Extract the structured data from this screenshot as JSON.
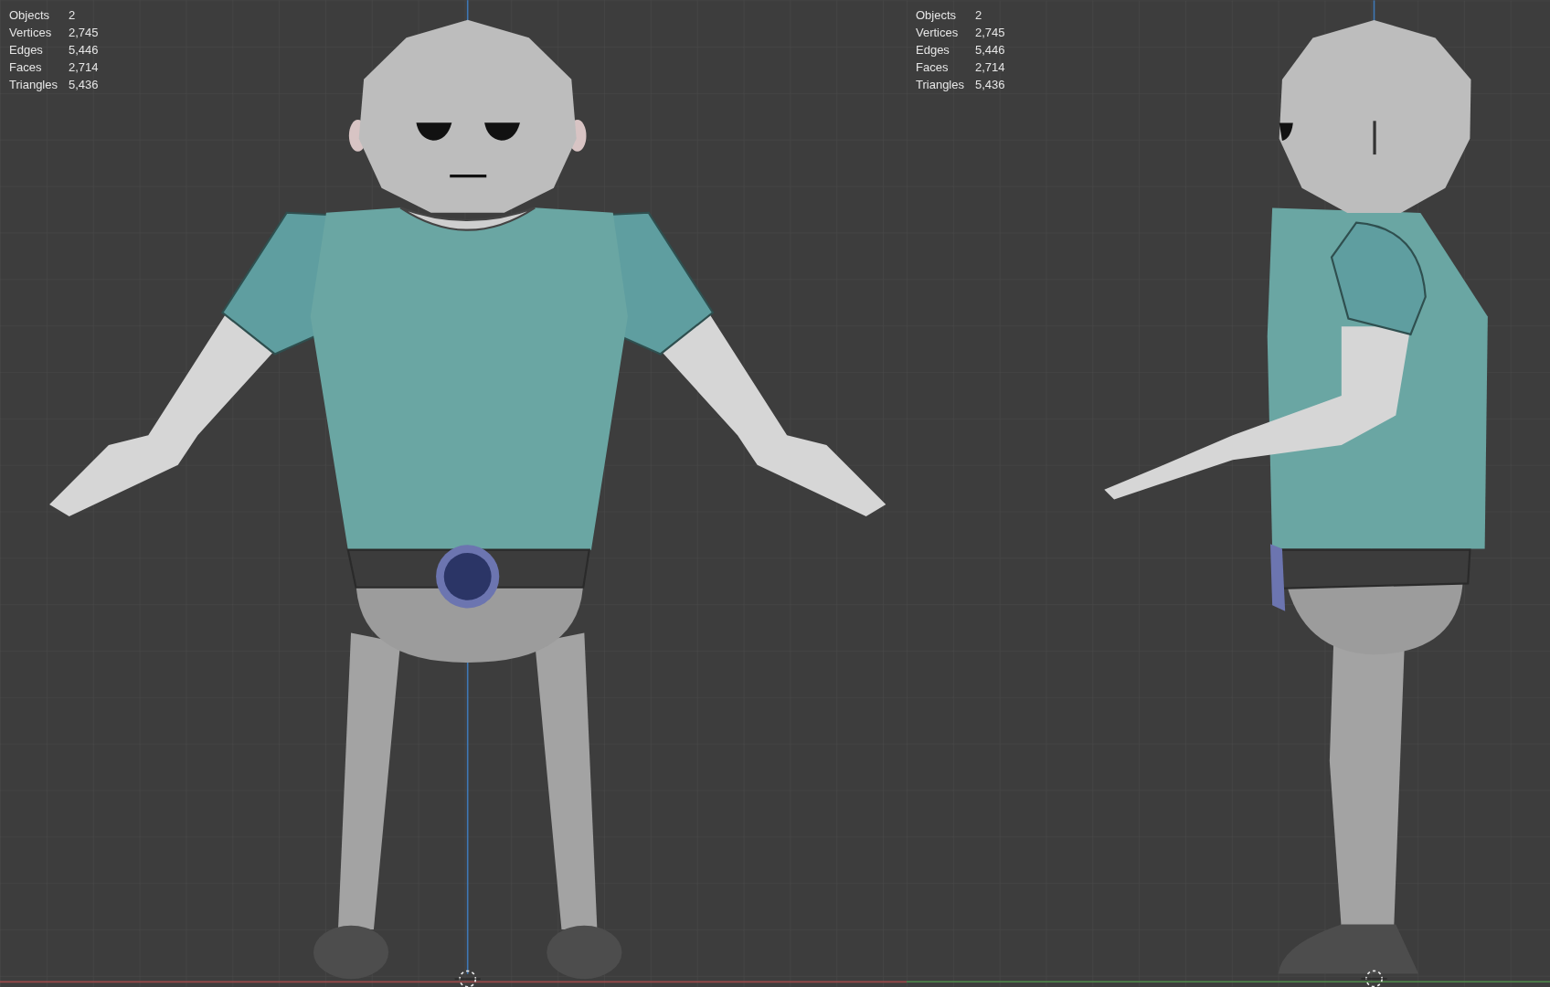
{
  "viewports": [
    {
      "kind": "front",
      "stats": [
        {
          "label": "Objects",
          "value": "2"
        },
        {
          "label": "Vertices",
          "value": "2,745"
        },
        {
          "label": "Edges",
          "value": "5,446"
        },
        {
          "label": "Faces",
          "value": "2,714"
        },
        {
          "label": "Triangles",
          "value": "5,436"
        }
      ]
    },
    {
      "kind": "side",
      "stats": [
        {
          "label": "Objects",
          "value": "2"
        },
        {
          "label": "Vertices",
          "value": "2,745"
        },
        {
          "label": "Edges",
          "value": "5,446"
        },
        {
          "label": "Faces",
          "value": "2,714"
        },
        {
          "label": "Triangles",
          "value": "5,436"
        }
      ]
    }
  ]
}
